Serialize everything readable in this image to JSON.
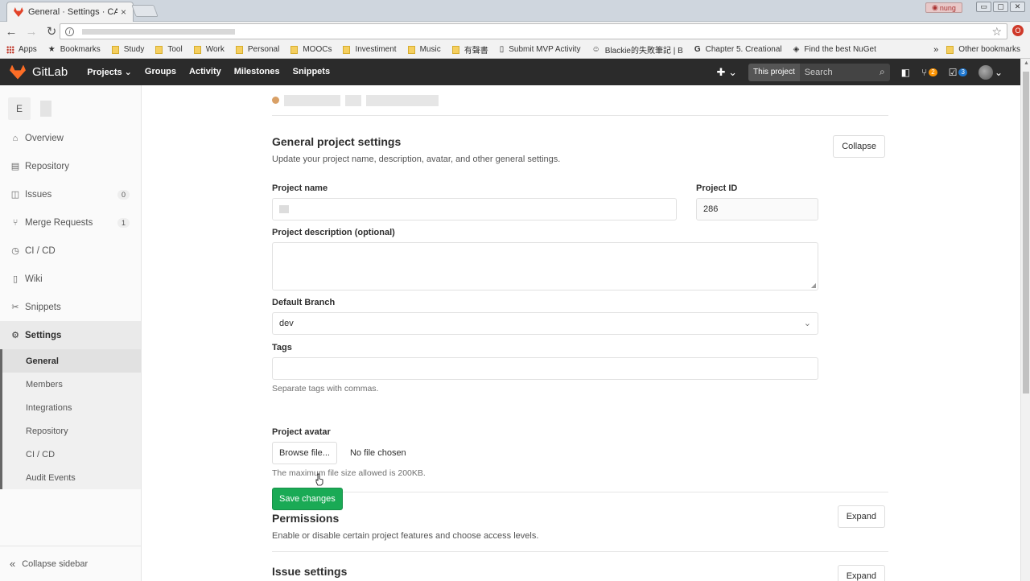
{
  "browser": {
    "tab_title": "General · Settings · CAS",
    "tab_close": "×",
    "win_user": "nung",
    "win_buttons": [
      "▭",
      "▢",
      "✕"
    ],
    "nav": {
      "back": "←",
      "forward": "→",
      "reload": "↻"
    },
    "info_glyph": "i",
    "star": "☆",
    "ext_glyph": "O",
    "bookmarks": [
      {
        "label": "Apps",
        "kind": "apps"
      },
      {
        "label": "Bookmarks",
        "kind": "star"
      },
      {
        "label": "Study",
        "kind": "folder"
      },
      {
        "label": "Tool",
        "kind": "folder"
      },
      {
        "label": "Work",
        "kind": "folder"
      },
      {
        "label": "Personal",
        "kind": "folder"
      },
      {
        "label": "MOOCs",
        "kind": "folder"
      },
      {
        "label": "Investiment",
        "kind": "folder"
      },
      {
        "label": "Music",
        "kind": "folder"
      },
      {
        "label": "有聲書",
        "kind": "folder"
      },
      {
        "label": "Submit MVP Activity",
        "kind": "page"
      },
      {
        "label": "Blackie的失敗筆記 | B",
        "kind": "page"
      },
      {
        "label": "Chapter 5. Creational",
        "kind": "google"
      },
      {
        "label": "Find the best NuGet",
        "kind": "page"
      }
    ],
    "more_glyph": "»",
    "other_bookmarks": "Other bookmarks"
  },
  "header": {
    "brand": "GitLab",
    "nav": [
      "Projects ⌄",
      "Groups",
      "Activity",
      "Milestones",
      "Snippets"
    ],
    "plus": "✚ ⌄",
    "scope": "This project",
    "search_placeholder": "Search",
    "search_glyph": "⌕",
    "sidebar_glyph": "◧",
    "mr_glyph": "⑂",
    "mr_count": "2",
    "todo_glyph": "☑",
    "todo_count": "3",
    "avatar_caret": "⌄"
  },
  "sidebar": {
    "project_initial": "E",
    "items": [
      {
        "icon": "⌂",
        "label": "Overview",
        "count": ""
      },
      {
        "icon": "▤",
        "label": "Repository",
        "count": ""
      },
      {
        "icon": "◫",
        "label": "Issues",
        "count": "0"
      },
      {
        "icon": "⑂",
        "label": "Merge Requests",
        "count": "1"
      },
      {
        "icon": "◷",
        "label": "CI / CD",
        "count": ""
      },
      {
        "icon": "▯",
        "label": "Wiki",
        "count": ""
      },
      {
        "icon": "✂",
        "label": "Snippets",
        "count": ""
      }
    ],
    "settings": {
      "icon": "⚙",
      "label": "Settings"
    },
    "sub_items": [
      "General",
      "Members",
      "Integrations",
      "Repository",
      "CI / CD",
      "Audit Events"
    ],
    "collapse": {
      "icon": "«",
      "label": "Collapse sidebar"
    }
  },
  "general": {
    "title": "General project settings",
    "description": "Update your project name, description, avatar, and other general settings.",
    "collapse_label": "Collapse",
    "project_name_label": "Project name",
    "project_id_label": "Project ID",
    "project_id": "286",
    "description_label": "Project description (optional)",
    "default_branch_label": "Default Branch",
    "default_branch": "dev",
    "select_caret": "⌄",
    "tags_label": "Tags",
    "tags_help": "Separate tags with commas.",
    "avatar_label": "Project avatar",
    "browse_label": "Browse file...",
    "no_file": "No file chosen",
    "avatar_help": "The maximum file size allowed is 200KB.",
    "save_label": "Save changes"
  },
  "permissions": {
    "title": "Permissions",
    "description": "Enable or disable certain project features and choose access levels.",
    "expand_label": "Expand"
  },
  "issue_settings": {
    "title": "Issue settings",
    "expand_label": "Expand"
  }
}
